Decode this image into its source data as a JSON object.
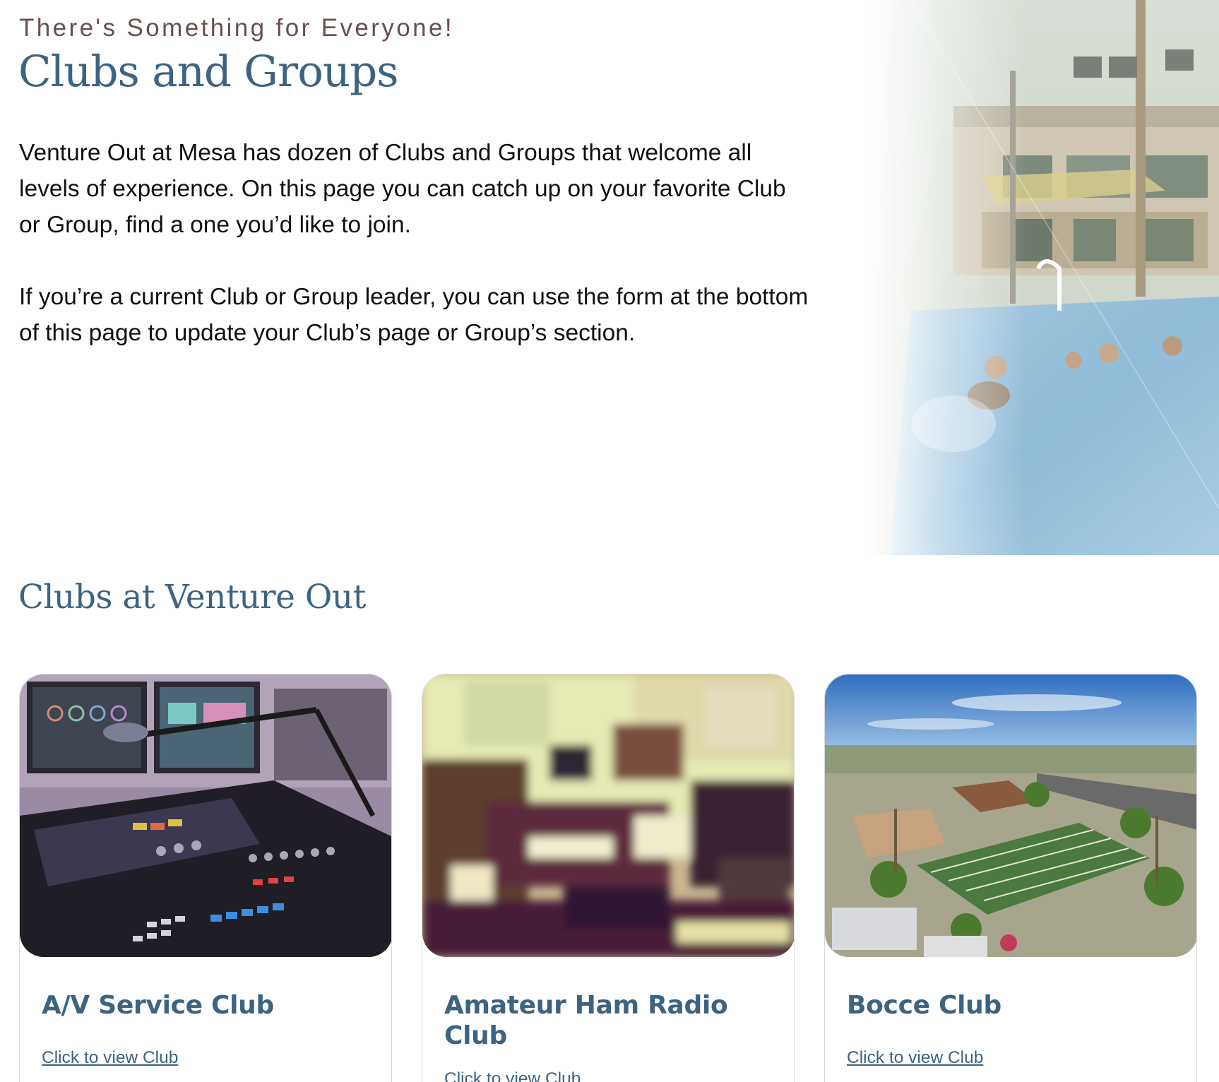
{
  "hero": {
    "eyebrow": "There's Something for Everyone!",
    "title": "Clubs and Groups",
    "paragraphs": [
      "Venture Out at Mesa has dozen of Clubs and Groups that welcome all levels of experience. On this page you can catch up on your favorite Club or Group, find a one you’d like to join.",
      "If you’re a current Club or Group leader, you can use the form at the bottom of this page to update your Club’s page or Group’s section."
    ]
  },
  "clubs_section": {
    "title": "Clubs at Venture Out",
    "cards": [
      {
        "title": "A/V Service Club",
        "link_label": "Click to view Club",
        "image_icon": "audio-mixer-image"
      },
      {
        "title": "Amateur Ham Radio Club",
        "link_label": "Click to view Club",
        "image_icon": "ham-radio-image"
      },
      {
        "title": "Bocce Club",
        "link_label": "Click to view Club",
        "image_icon": "bocce-courts-aerial-image"
      }
    ]
  },
  "colors": {
    "heading_blue": "#3c6482",
    "eyebrow_brown": "#6b4e4e",
    "body_text": "#111111"
  }
}
